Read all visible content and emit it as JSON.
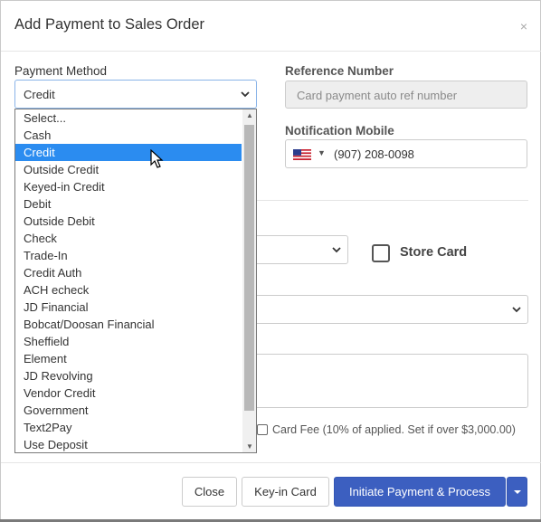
{
  "dialog": {
    "title": "Add Payment to Sales Order",
    "close_glyph": "×"
  },
  "payment_method": {
    "label": "Payment Method",
    "value": "Credit",
    "options": [
      "Select...",
      "Cash",
      "Credit",
      "Outside Credit",
      "Keyed-in Credit",
      "Debit",
      "Outside Debit",
      "Check",
      "Trade-In",
      "Credit Auth",
      "ACH echeck",
      "JD Financial",
      "Bobcat/Doosan Financial",
      "Sheffield",
      "Element",
      "JD Revolving",
      "Vendor Credit",
      "Government",
      "Text2Pay",
      "Use Deposit"
    ],
    "highlighted_option": "Credit"
  },
  "reference_number": {
    "label": "Reference Number",
    "placeholder": "Card payment auto ref number"
  },
  "notification_mobile": {
    "label": "Notification Mobile",
    "value": "(907) 208-0098",
    "flag_icon": "us-flag-icon"
  },
  "store_card": {
    "label": "Store Card",
    "checked": false
  },
  "card_fee": {
    "label": "Card Fee (10% of applied. Set if over $3,000.00)",
    "checked": false
  },
  "footer": {
    "close_label": "Close",
    "keyin_label": "Key-in Card",
    "primary_label": "Initiate Payment & Process"
  },
  "colors": {
    "primary": "#3c5fc0",
    "highlight": "#2b8cf0",
    "focus_border": "#8ab4e8"
  }
}
